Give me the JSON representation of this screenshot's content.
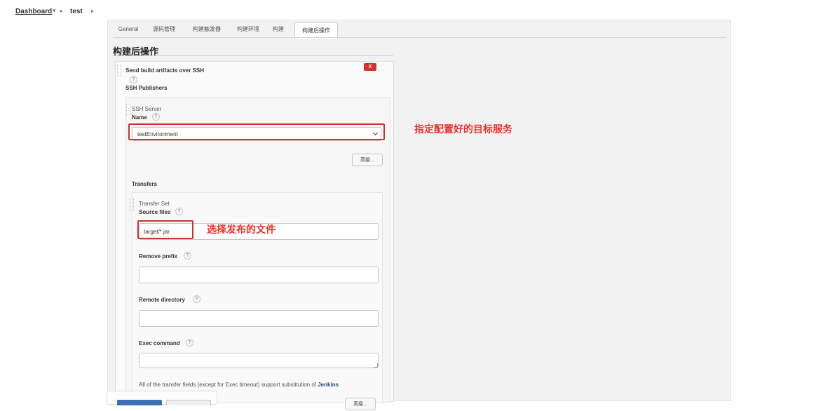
{
  "breadcrumb": {
    "dashboard": "Dashboard",
    "sep": "▸",
    "job": "test",
    "arrow_down": "▾"
  },
  "tabs": [
    "General",
    "源码管理",
    "构建触发器",
    "构建环境",
    "构建",
    "构建后操作"
  ],
  "active_tab": "构建后操作",
  "section_title": "构建后操作",
  "plugin": {
    "title": "Send build artifacts over SSH",
    "delete_label": "X",
    "publishers_label": "SSH Publishers",
    "server": {
      "title": "SSH Server",
      "name_label": "Name",
      "name_value": "testEnvironment",
      "advanced_label": "高级..."
    },
    "transfers_label": "Transfers",
    "transfer_set": {
      "title": "Transfer Set",
      "source_files_label": "Source files",
      "source_files_value": "target/*.jar",
      "remove_prefix_label": "Remove prefix",
      "remove_prefix_value": "",
      "remote_directory_label": "Remote directory",
      "remote_directory_value": "",
      "exec_command_label": "Exec command",
      "exec_command_value": "",
      "note_prefix": "All of the transfer fields (except for Exec timeout) support substitution of ",
      "note_link": "Jenkins environment variables",
      "advanced_label": "高级..."
    }
  },
  "help_glyph": "?",
  "annotations": {
    "server": "指定配置好的目标服务",
    "source": "选择发布的文件"
  },
  "colors": {
    "annotation_red": "#c9352e",
    "link_blue": "#204a87",
    "delete_red": "#d2322d"
  }
}
